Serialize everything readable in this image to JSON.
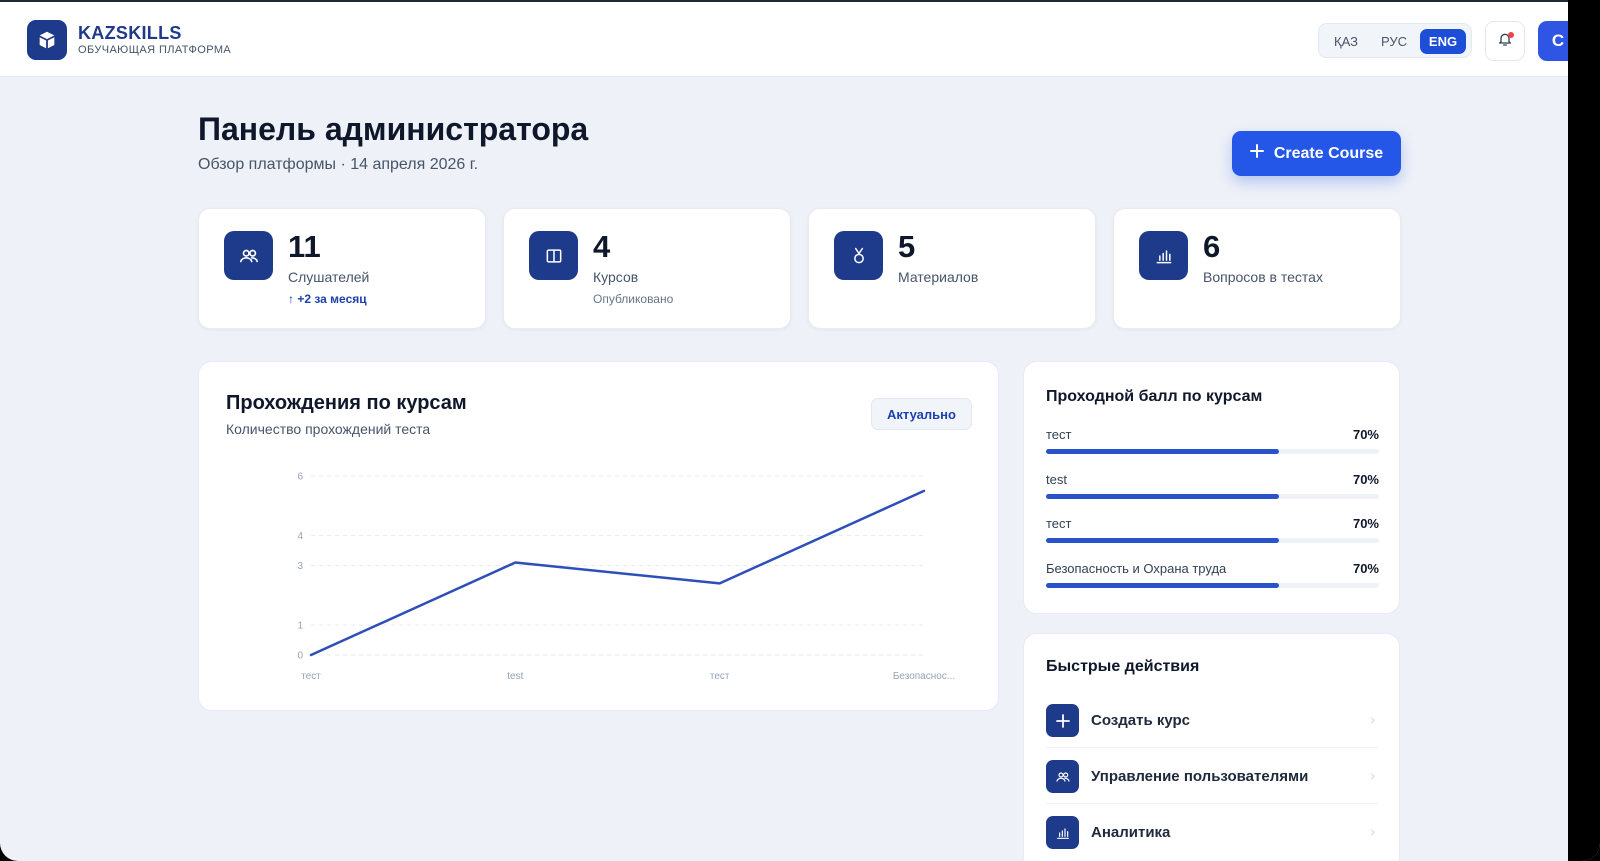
{
  "header": {
    "brand_title": "KAZSKILLS",
    "brand_subtitle": "ОБУЧАЮЩАЯ ПЛАТФОРМА",
    "languages": [
      "ҚАЗ",
      "РУС",
      "ENG"
    ],
    "active_language": "ENG",
    "avatar_initial": "C"
  },
  "page": {
    "title": "Панель администратора",
    "subtitle": "Обзор платформы · 14 апреля 2026 г.",
    "create_button": "Create Course"
  },
  "stats": [
    {
      "value": "11",
      "label": "Слушателей",
      "extra": "+2 за месяц",
      "icon": "users-icon"
    },
    {
      "value": "4",
      "label": "Курсов",
      "extra": "Опубликовано",
      "icon": "book-icon"
    },
    {
      "value": "5",
      "label": "Материалов",
      "extra": "",
      "icon": "medal-icon"
    },
    {
      "value": "6",
      "label": "Вопросов в тестах",
      "extra": "",
      "icon": "bar-chart-icon"
    }
  ],
  "chart": {
    "title": "Прохождения по курсам",
    "subtitle": "Количество прохождений теста",
    "badge": "Актуально"
  },
  "chart_data": {
    "type": "line",
    "title": "Прохождения по курсам",
    "categories": [
      "тест",
      "test",
      "тест",
      "Безопаснос..."
    ],
    "series": [
      {
        "values": [
          0,
          3.1,
          2.4,
          5.5
        ]
      }
    ],
    "y_ticks": [
      "0",
      "1",
      "3",
      "4",
      "6"
    ],
    "ylim": [
      0,
      6
    ],
    "grid": true,
    "color": "#2f4fb8"
  },
  "passing": {
    "title": "Проходной балл по курсам",
    "rows": [
      {
        "name": "тест",
        "percent": "70%",
        "value": 0.7
      },
      {
        "name": "test",
        "percent": "70%",
        "value": 0.7
      },
      {
        "name": "тест",
        "percent": "70%",
        "value": 0.7
      },
      {
        "name": "Безопасность и Охрана труда",
        "percent": "70%",
        "value": 0.7
      }
    ]
  },
  "quick_actions": {
    "title": "Быстрые действия",
    "items": [
      {
        "label": "Создать курс",
        "icon": "plus-icon"
      },
      {
        "label": "Управление пользователями",
        "icon": "users-icon"
      },
      {
        "label": "Аналитика",
        "icon": "bar-chart-icon"
      }
    ]
  },
  "colors": {
    "brand": "#1e3a8a",
    "accent": "#2457e8",
    "background": "#eef1f7"
  }
}
